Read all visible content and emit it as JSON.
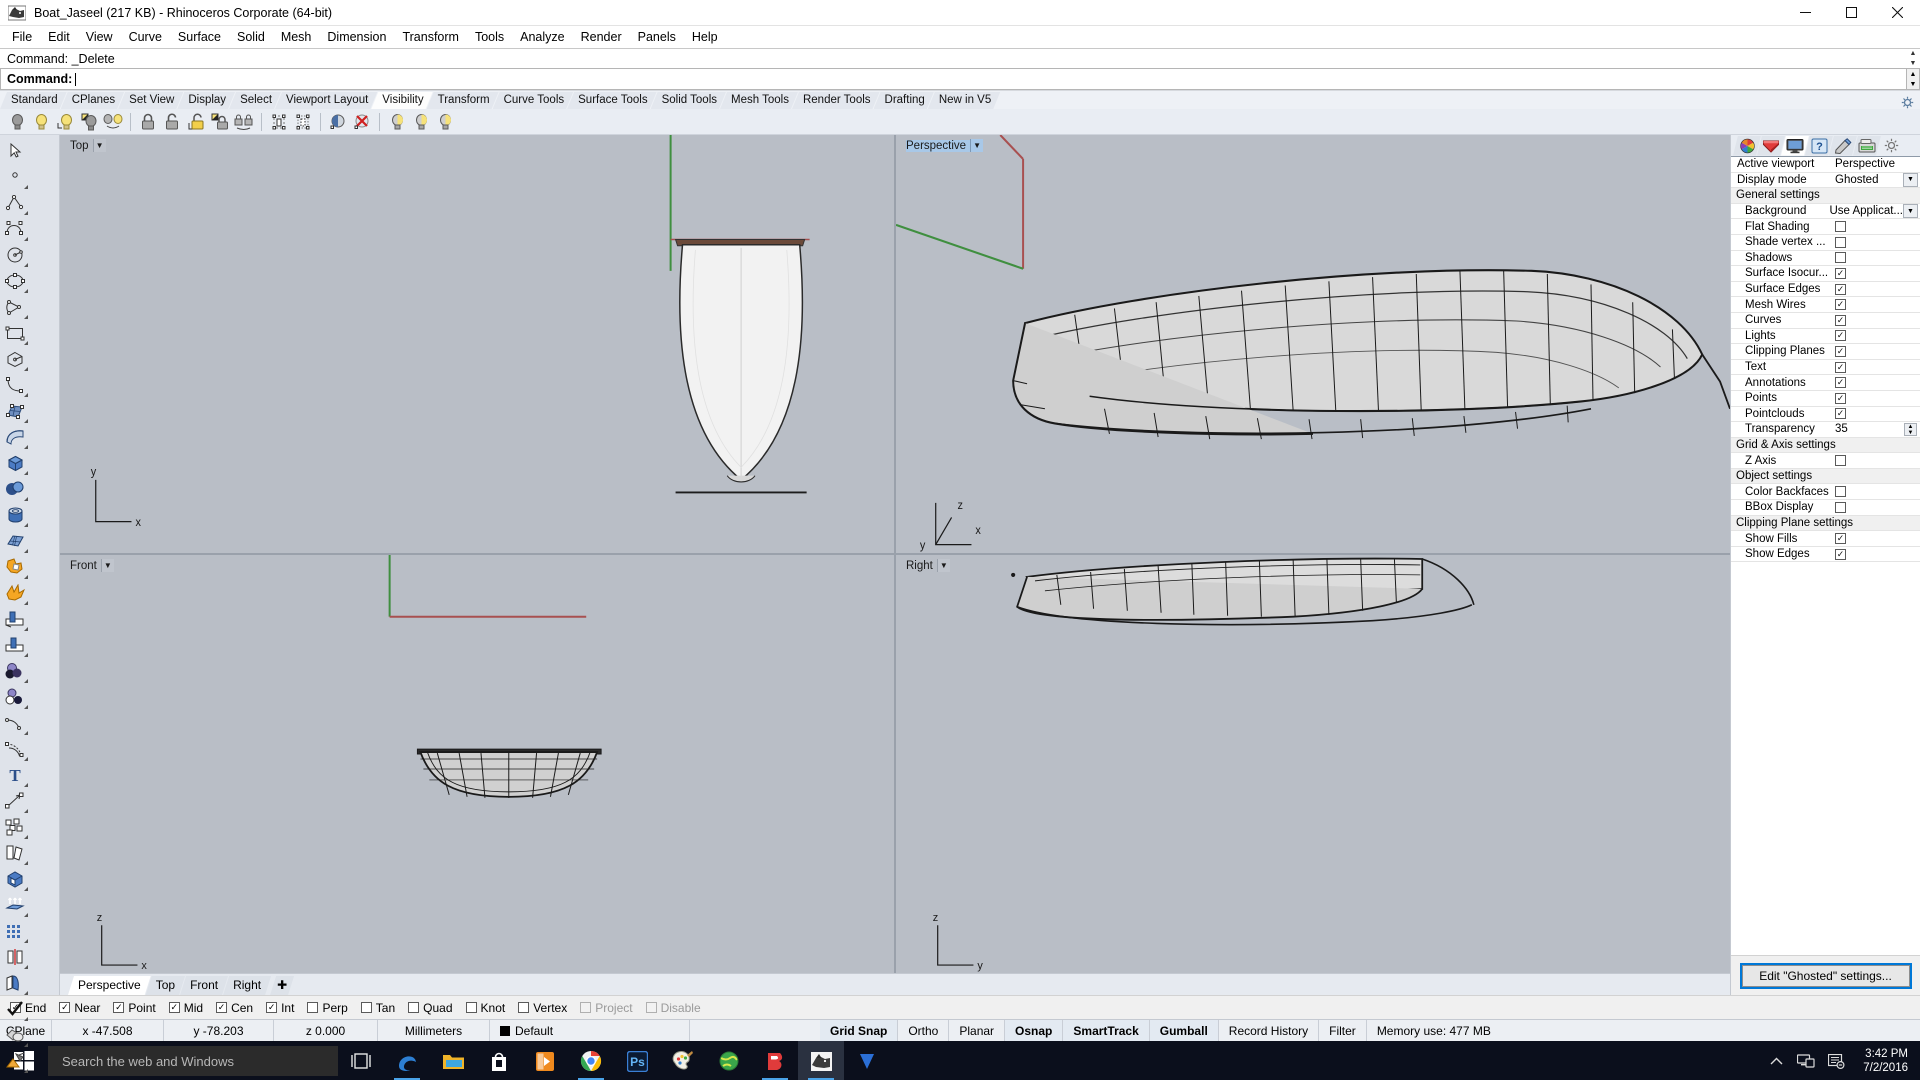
{
  "window": {
    "title": "Boat_Jaseel (217 KB) - Rhinoceros Corporate (64-bit)",
    "app_icon": "rhino-icon",
    "minimize": "—",
    "maximize": "❐",
    "close": "✕"
  },
  "menubar": {
    "items": [
      "File",
      "Edit",
      "View",
      "Curve",
      "Surface",
      "Solid",
      "Mesh",
      "Dimension",
      "Transform",
      "Tools",
      "Analyze",
      "Render",
      "Panels",
      "Help"
    ]
  },
  "command": {
    "history_label": "Command: _Delete",
    "prompt_label": "Command:",
    "input_value": ""
  },
  "toolbar_tabs": {
    "items": [
      "Standard",
      "CPlanes",
      "Set View",
      "Display",
      "Select",
      "Viewport Layout",
      "Visibility",
      "Transform",
      "Curve Tools",
      "Surface Tools",
      "Solid Tools",
      "Mesh Tools",
      "Render Tools",
      "Drafting",
      "New in V5"
    ],
    "active": "Visibility"
  },
  "icon_toolbar": {
    "buttons": [
      {
        "name": "hide-objects-icon"
      },
      {
        "name": "show-objects-icon"
      },
      {
        "name": "show-selected-objects-icon"
      },
      {
        "name": "hide-swap-icon"
      },
      {
        "name": "show-in-other-viewports-icon"
      },
      {
        "name": "lock-objects-icon"
      },
      {
        "name": "unlock-objects-icon"
      },
      {
        "name": "unlock-selected-icon"
      },
      {
        "name": "lock-swap-icon"
      },
      {
        "name": "lock-sync-icon"
      },
      {
        "name": "isolate-objects-icon"
      },
      {
        "name": "unisolate-objects-icon"
      },
      {
        "name": "ghosted-toggle-icon"
      },
      {
        "name": "remove-ghost-icon"
      },
      {
        "name": "light-a-icon"
      },
      {
        "name": "light-b-icon"
      },
      {
        "name": "light-c-icon"
      }
    ]
  },
  "left_toolbar": {
    "buttons": [
      {
        "name": "select-arrow-icon"
      },
      {
        "name": "point-icon"
      },
      {
        "name": "polyline-icon"
      },
      {
        "name": "control-point-curve-icon"
      },
      {
        "name": "circle-icon"
      },
      {
        "name": "ellipse-icon"
      },
      {
        "name": "arc-icon"
      },
      {
        "name": "rectangle-icon"
      },
      {
        "name": "polygon-icon"
      },
      {
        "name": "free-form-curve-icon"
      },
      {
        "name": "surface-from-points-icon"
      },
      {
        "name": "extrude-surface-icon"
      },
      {
        "name": "box-solid-icon"
      },
      {
        "name": "sphere-solid-icon"
      },
      {
        "name": "cylinder-solid-icon"
      },
      {
        "name": "mesh-plane-icon"
      },
      {
        "name": "boolean-union-icon"
      },
      {
        "name": "explode-icon"
      },
      {
        "name": "trim-icon"
      },
      {
        "name": "split-icon"
      },
      {
        "name": "layer-material-icon"
      },
      {
        "name": "object-properties-icon"
      },
      {
        "name": "fillet-curve-icon"
      },
      {
        "name": "offset-curve-icon"
      },
      {
        "name": "text-icon"
      },
      {
        "name": "dimension-icon"
      },
      {
        "name": "group-icon"
      },
      {
        "name": "copy-icon"
      },
      {
        "name": "cap-planar-holes-icon"
      },
      {
        "name": "extrude-straight-icon"
      },
      {
        "name": "array-icon"
      },
      {
        "name": "mirror-icon"
      },
      {
        "name": "unroll-surface-icon"
      },
      {
        "name": "check-objects-icon"
      },
      {
        "name": "boolean-difference-icon"
      },
      {
        "name": "render-color-icon"
      }
    ]
  },
  "viewports": [
    {
      "name": "Top",
      "active": false
    },
    {
      "name": "Perspective",
      "active": true
    },
    {
      "name": "Front",
      "active": false
    },
    {
      "name": "Right",
      "active": false
    }
  ],
  "viewport_tabs": {
    "items": [
      "Perspective",
      "Top",
      "Front",
      "Right"
    ],
    "active": "Perspective",
    "add_label": "✚"
  },
  "properties_panel": {
    "tabs": [
      {
        "name": "layers-tab",
        "active": false
      },
      {
        "name": "properties-tab",
        "active": false
      },
      {
        "name": "display-tab",
        "active": true
      },
      {
        "name": "help-tab",
        "active": false
      },
      {
        "name": "notes-tab",
        "active": false
      },
      {
        "name": "render-tab",
        "active": false
      },
      {
        "name": "options-gear-tab",
        "active": false
      }
    ],
    "rows": [
      {
        "type": "value",
        "label": "Active viewport",
        "value": "Perspective",
        "indent": false
      },
      {
        "type": "combo",
        "label": "Display mode",
        "value": "Ghosted",
        "indent": false
      },
      {
        "type": "section",
        "label": "General settings"
      },
      {
        "type": "combo",
        "label": "Background",
        "value": "Use Applicat...",
        "indent": true
      },
      {
        "type": "checkbox",
        "label": "Flat Shading",
        "checked": false,
        "indent": true
      },
      {
        "type": "checkbox",
        "label": "Shade vertex ...",
        "checked": false,
        "indent": true
      },
      {
        "type": "checkbox",
        "label": "Shadows",
        "checked": false,
        "indent": true
      },
      {
        "type": "checkbox",
        "label": "Surface Isocur...",
        "checked": true,
        "indent": true
      },
      {
        "type": "checkbox",
        "label": "Surface Edges",
        "checked": true,
        "indent": true
      },
      {
        "type": "checkbox",
        "label": "Mesh Wires",
        "checked": true,
        "indent": true
      },
      {
        "type": "checkbox",
        "label": "Curves",
        "checked": true,
        "indent": true
      },
      {
        "type": "checkbox",
        "label": "Lights",
        "checked": true,
        "indent": true
      },
      {
        "type": "checkbox",
        "label": "Clipping Planes",
        "checked": true,
        "indent": true
      },
      {
        "type": "checkbox",
        "label": "Text",
        "checked": true,
        "indent": true
      },
      {
        "type": "checkbox",
        "label": "Annotations",
        "checked": true,
        "indent": true
      },
      {
        "type": "checkbox",
        "label": "Points",
        "checked": true,
        "indent": true
      },
      {
        "type": "checkbox",
        "label": "Pointclouds",
        "checked": true,
        "indent": true
      },
      {
        "type": "spinner",
        "label": "Transparency",
        "value": "35",
        "indent": true
      },
      {
        "type": "section",
        "label": "Grid & Axis settings"
      },
      {
        "type": "checkbox",
        "label": "Z Axis",
        "checked": false,
        "indent": true
      },
      {
        "type": "section",
        "label": "Object settings"
      },
      {
        "type": "checkbox",
        "label": "Color Backfaces",
        "checked": false,
        "indent": true
      },
      {
        "type": "checkbox",
        "label": "BBox Display",
        "checked": false,
        "indent": true
      },
      {
        "type": "section",
        "label": "Clipping Plane settings"
      },
      {
        "type": "checkbox",
        "label": "Show Fills",
        "checked": true,
        "indent": true
      },
      {
        "type": "checkbox",
        "label": "Show Edges",
        "checked": true,
        "indent": true
      }
    ],
    "edit_button": "Edit \"Ghosted\" settings..."
  },
  "osnap": {
    "items": [
      {
        "label": "End",
        "checked": true,
        "disabled": false
      },
      {
        "label": "Near",
        "checked": true,
        "disabled": false
      },
      {
        "label": "Point",
        "checked": true,
        "disabled": false
      },
      {
        "label": "Mid",
        "checked": true,
        "disabled": false
      },
      {
        "label": "Cen",
        "checked": true,
        "disabled": false
      },
      {
        "label": "Int",
        "checked": true,
        "disabled": false
      },
      {
        "label": "Perp",
        "checked": false,
        "disabled": false
      },
      {
        "label": "Tan",
        "checked": false,
        "disabled": false
      },
      {
        "label": "Quad",
        "checked": false,
        "disabled": false
      },
      {
        "label": "Knot",
        "checked": false,
        "disabled": false
      },
      {
        "label": "Vertex",
        "checked": false,
        "disabled": false
      },
      {
        "label": "Project",
        "checked": false,
        "disabled": true
      },
      {
        "label": "Disable",
        "checked": false,
        "disabled": true
      }
    ]
  },
  "statusbar": {
    "cplane": "CPlane",
    "x": "x -47.508",
    "y": "y -78.203",
    "z": "z 0.000",
    "units": "Millimeters",
    "layer": "Default",
    "layer_color": "#000000",
    "toggles": [
      {
        "label": "Grid Snap",
        "active": true
      },
      {
        "label": "Ortho",
        "active": false
      },
      {
        "label": "Planar",
        "active": false
      },
      {
        "label": "Osnap",
        "active": true
      },
      {
        "label": "SmartTrack",
        "active": true
      },
      {
        "label": "Gumball",
        "active": true
      },
      {
        "label": "Record History",
        "active": false
      },
      {
        "label": "Filter",
        "active": false
      }
    ],
    "memory": "Memory use: 477 MB"
  },
  "taskbar": {
    "start_icon": "windows-start-icon",
    "search_placeholder": "Search the web and Windows",
    "icons": [
      {
        "name": "task-view-icon",
        "running": false
      },
      {
        "name": "edge-browser-icon",
        "running": true
      },
      {
        "name": "file-explorer-icon",
        "running": false
      },
      {
        "name": "windows-store-icon",
        "running": false
      },
      {
        "name": "media-player-icon",
        "running": false
      },
      {
        "name": "chrome-browser-icon",
        "running": true
      },
      {
        "name": "photoshop-icon",
        "running": false
      },
      {
        "name": "paint-icon",
        "running": false
      },
      {
        "name": "globe-browser-icon",
        "running": false
      },
      {
        "name": "sketchup-icon",
        "running": true
      },
      {
        "name": "rhinoceros-icon",
        "running": true
      },
      {
        "name": "v-ray-icon",
        "running": false
      }
    ],
    "tray": [
      {
        "name": "show-hidden-icons-chevron"
      },
      {
        "name": "network-icon"
      },
      {
        "name": "action-center-icon"
      }
    ],
    "clock_time": "3:42 PM",
    "clock_date": "7/2/2016"
  },
  "colors": {
    "viewport_bg": "#b9bec6",
    "accent": "#0078d7",
    "axis_x": "#b05a5a",
    "axis_y": "#4f9a4f",
    "active_tab": "#a8c8e8"
  }
}
